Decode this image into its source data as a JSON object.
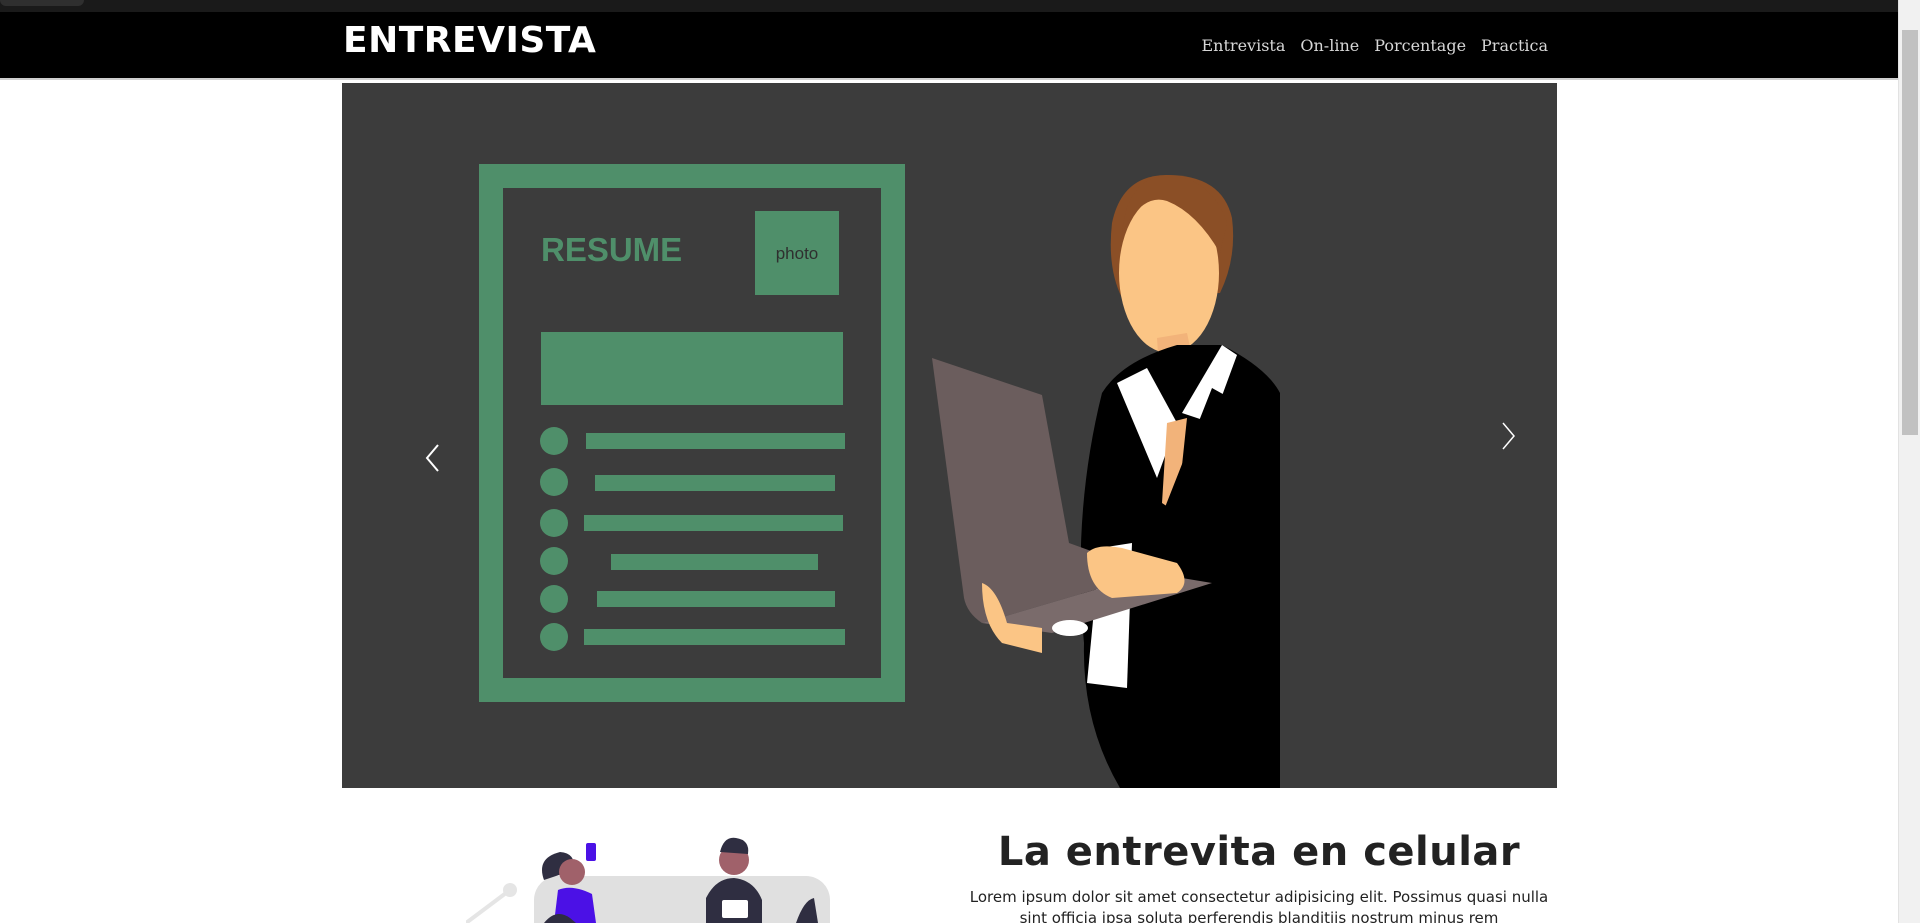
{
  "navbar": {
    "brand": "ENTREVISTA",
    "links": [
      {
        "label": "Entrevista"
      },
      {
        "label": "On-line"
      },
      {
        "label": "Porcentage"
      },
      {
        "label": "Practica"
      }
    ]
  },
  "carousel": {
    "resume_title": "RESUME",
    "photo_label": "photo",
    "prev_icon": "chevron-left-icon",
    "next_icon": "chevron-right-icon"
  },
  "feature": {
    "title": "La entrevita en celular",
    "text": "Lorem ipsum dolor sit amet consectetur adipisicing elit. Possimus quasi nulla sint officia ipsa soluta perferendis blanditiis nostrum minus rem"
  },
  "colors": {
    "navbar_bg": "#000000",
    "carousel_bg": "#3c3c3c",
    "resume_green": "#4f8f6a",
    "illustration_accent": "#4b11e6"
  }
}
